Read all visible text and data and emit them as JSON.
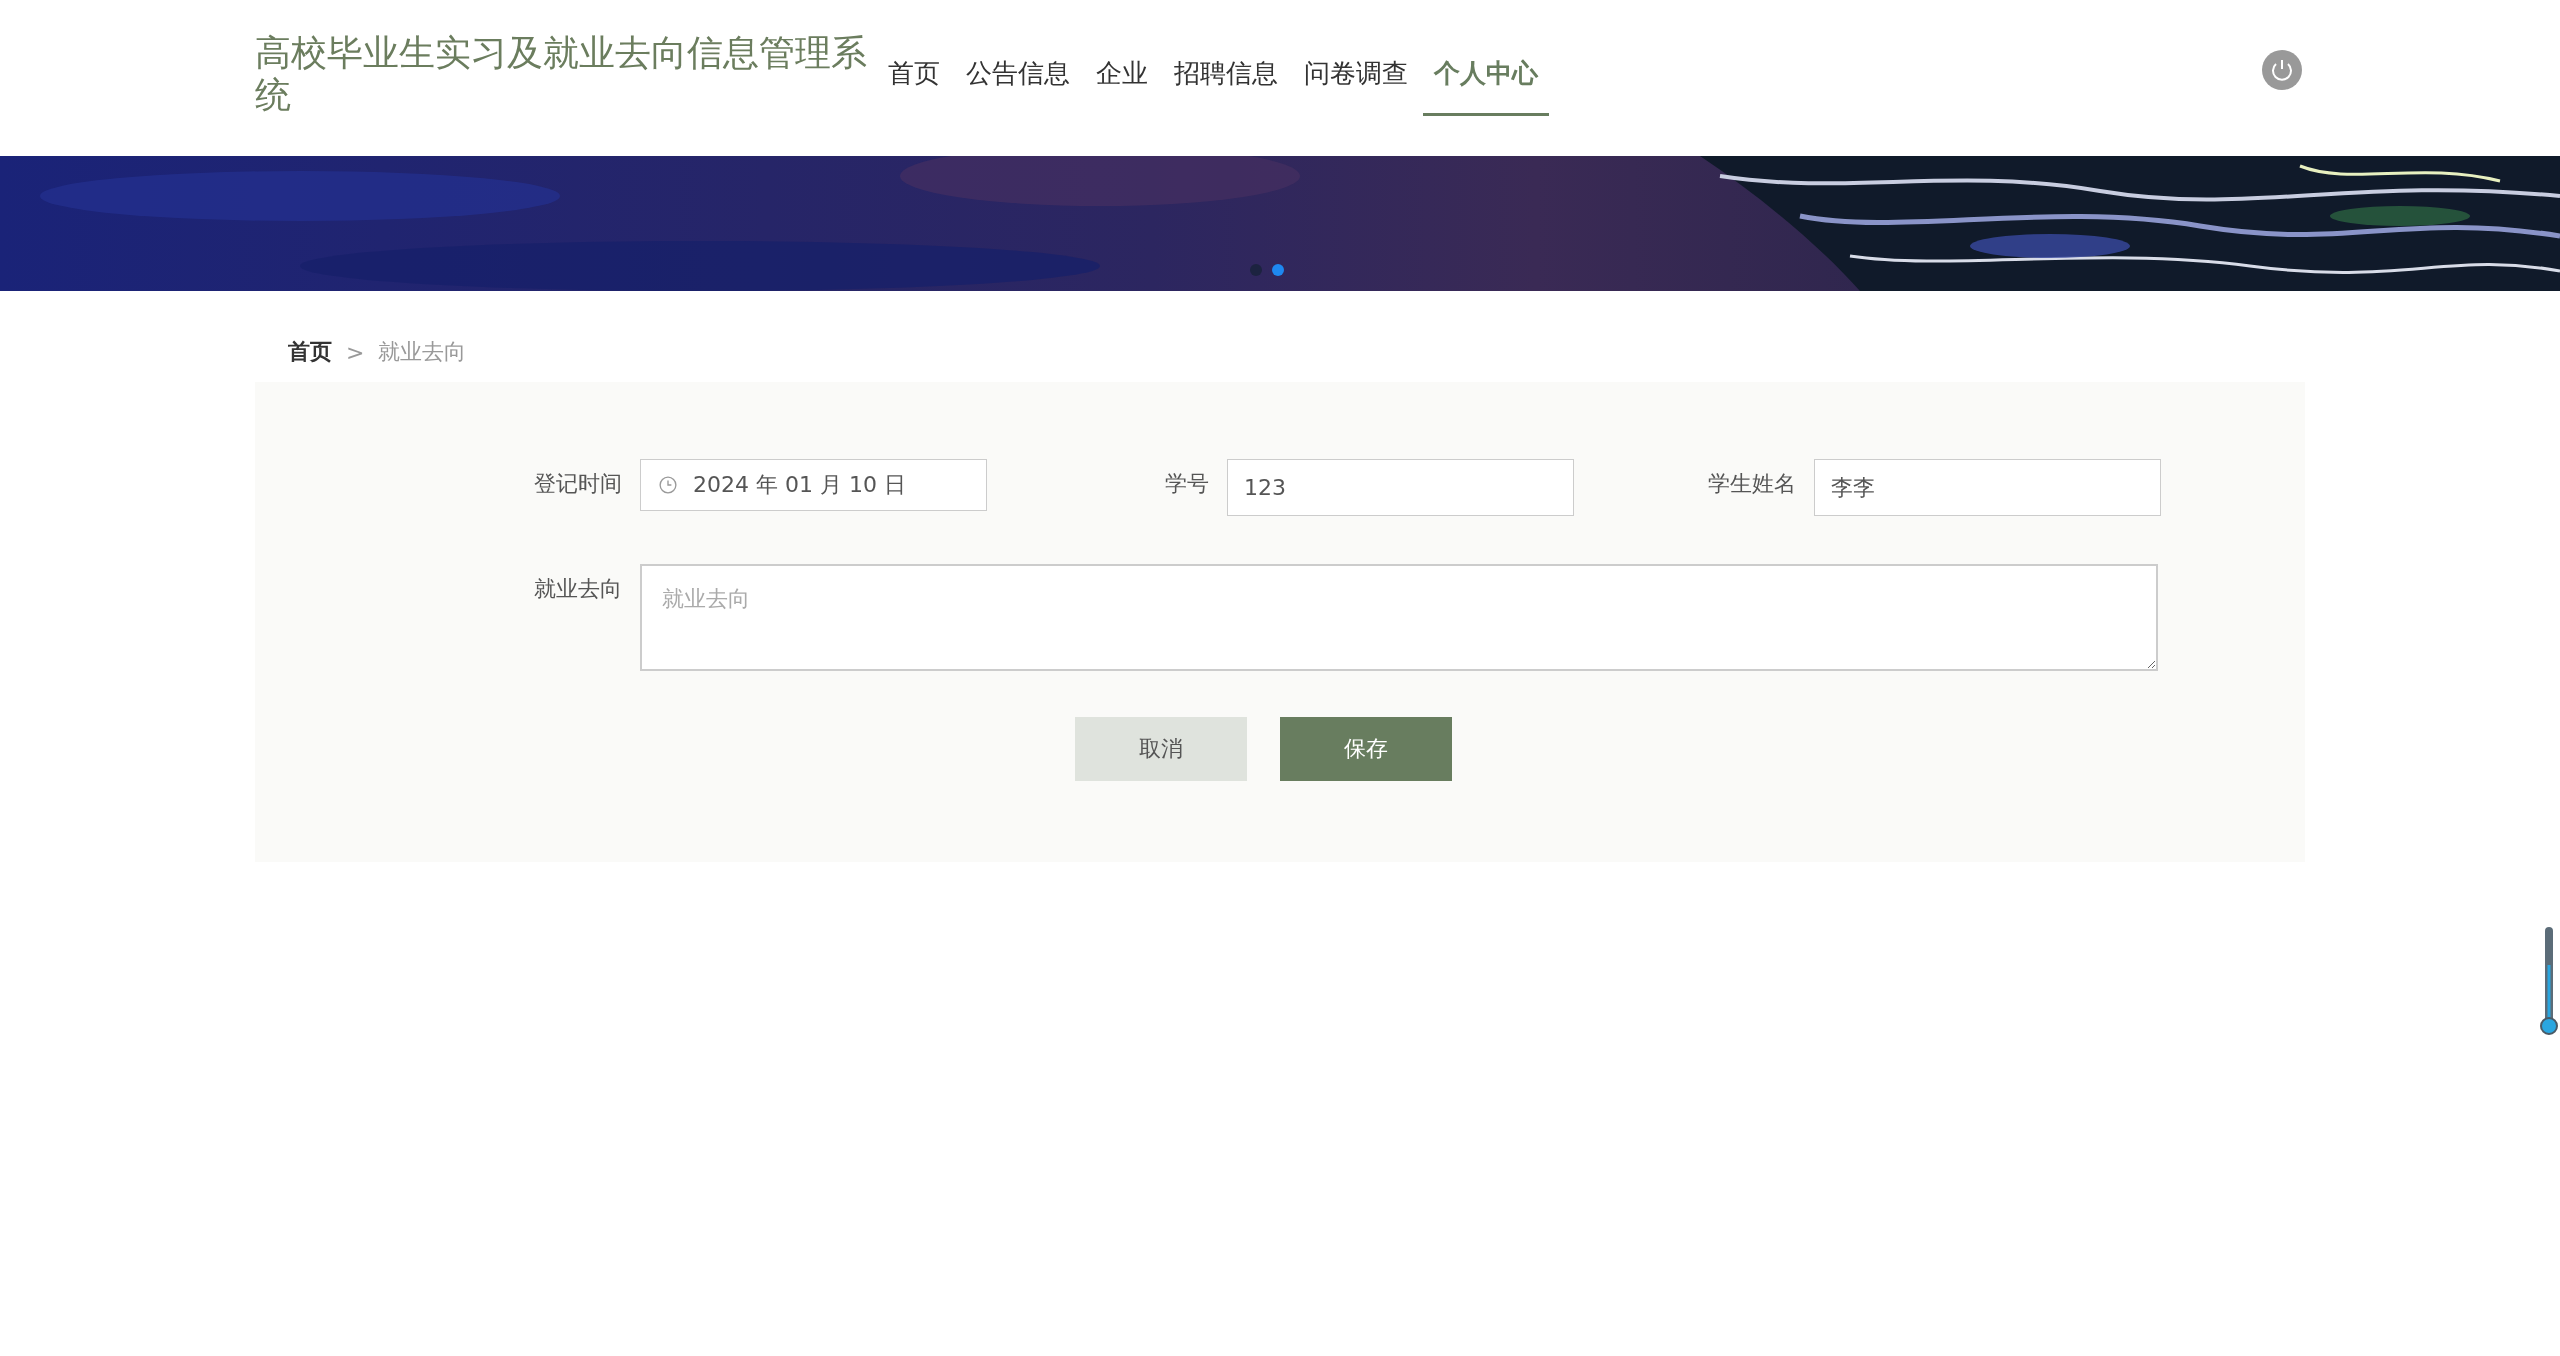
{
  "header": {
    "title": "高校毕业生实习及就业去向信息管理系统",
    "nav": [
      {
        "label": "首页",
        "selected": false
      },
      {
        "label": "公告信息",
        "selected": false
      },
      {
        "label": "企业",
        "selected": false
      },
      {
        "label": "招聘信息",
        "selected": false
      },
      {
        "label": "问卷调查",
        "selected": false
      },
      {
        "label": "个人中心",
        "selected": true
      }
    ]
  },
  "banner": {
    "dots": [
      {
        "selected": false
      },
      {
        "selected": true
      }
    ]
  },
  "breadcrumb": {
    "separator": ">",
    "items": [
      {
        "label": "首页",
        "selected": false
      },
      {
        "label": "就业去向",
        "selected": true
      }
    ]
  },
  "form": {
    "fields": [
      {
        "label": "登记时间",
        "kind": "date",
        "value": "2024 年 01 月 10 日"
      },
      {
        "label": "学号",
        "kind": "text",
        "value": "123"
      },
      {
        "label": "学生姓名",
        "kind": "text",
        "value": "李李"
      },
      {
        "label": "就业去向",
        "kind": "textarea",
        "placeholder": "就业去向"
      }
    ],
    "buttons": [
      {
        "label": "取消",
        "kind": "secondary"
      },
      {
        "label": "保存",
        "kind": "primary"
      }
    ]
  }
}
